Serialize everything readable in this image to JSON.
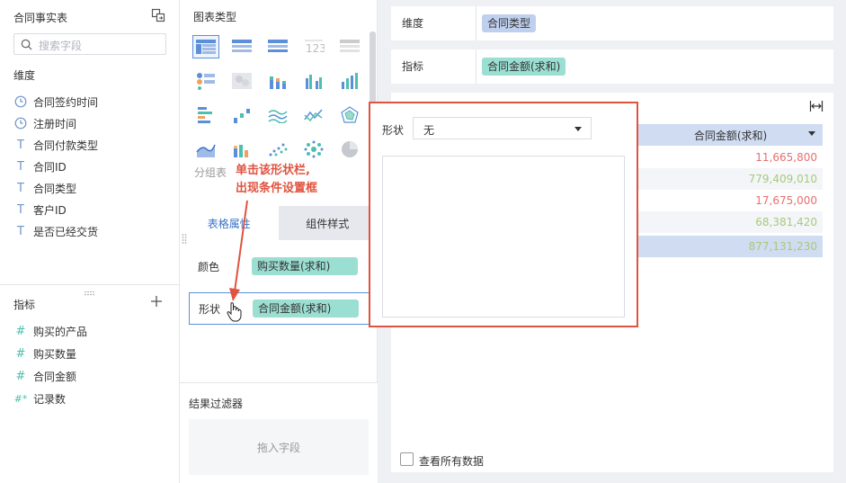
{
  "left": {
    "title": "合同事实表",
    "search_placeholder": "搜索字段",
    "dimension_label": "维度",
    "dimensions": [
      {
        "label": "合同签约时间",
        "type": "time"
      },
      {
        "label": "注册时间",
        "type": "time"
      },
      {
        "label": "合同付款类型",
        "type": "text"
      },
      {
        "label": "合同ID",
        "type": "text"
      },
      {
        "label": "合同类型",
        "type": "text"
      },
      {
        "label": "客户ID",
        "type": "text"
      },
      {
        "label": "是否已经交货",
        "type": "text"
      }
    ],
    "measure_label": "指标",
    "measures": [
      {
        "label": "购买的产品",
        "icon": "#"
      },
      {
        "label": "购买数量",
        "icon": "#"
      },
      {
        "label": "合同金额",
        "icon": "#"
      },
      {
        "label": "记录数",
        "icon": "#*"
      }
    ]
  },
  "middle": {
    "chart_type_label": "图表类型",
    "group_table_label": "分组表",
    "tabs": [
      "表格属性",
      "组件样式"
    ],
    "color_label": "颜色",
    "color_field": "购买数量(求和)",
    "shape_label": "形状",
    "shape_field": "合同金额(求和)",
    "filter_label": "结果过滤器",
    "drop_hint": "拖入字段"
  },
  "right": {
    "dimension_label": "维度",
    "dimension_field": "合同类型",
    "measure_label": "指标",
    "measure_field": "合同金额(求和)",
    "column_header": "合同金额(求和)",
    "values": [
      "11,665,800",
      "779,409,010",
      "17,675,000",
      "68,381,420",
      "877,131,230"
    ],
    "value_colors": [
      "#e86f6f",
      "#a9c97a",
      "#e86f6f",
      "#a9c97a",
      "#a9c97a"
    ],
    "show_all_label": "查看所有数据"
  },
  "popup": {
    "shape_label": "形状",
    "shape_value": "无"
  },
  "annotation": {
    "line1": "单击该形状栏,",
    "line2": "出现条件设置框"
  }
}
